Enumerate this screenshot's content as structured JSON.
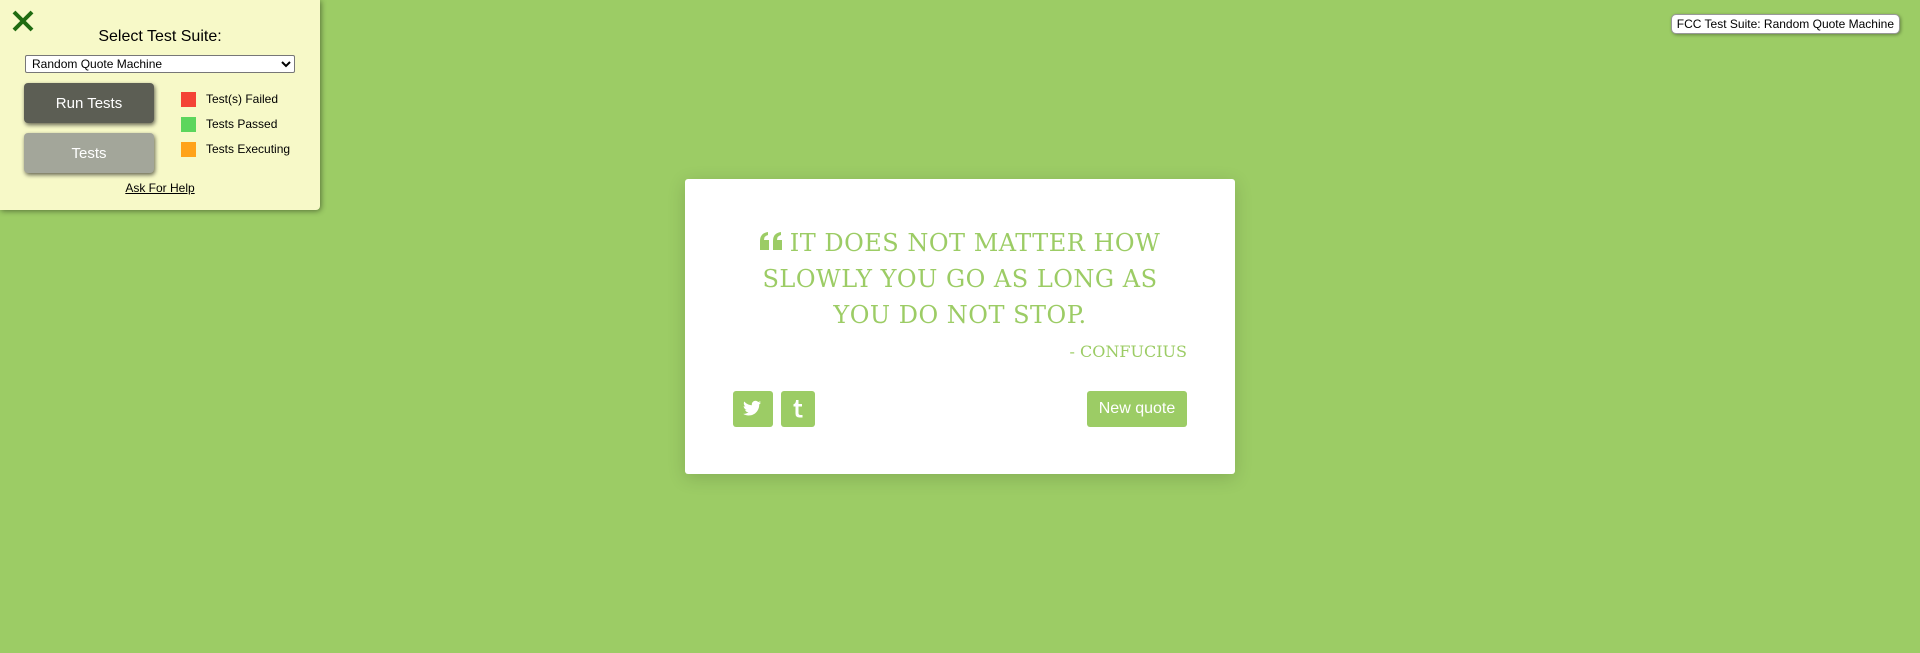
{
  "test_panel": {
    "title": "Select Test Suite:",
    "selected_suite": "Random Quote Machine",
    "run_tests_label": "Run Tests",
    "tests_label": "Tests",
    "help_label": "Ask For Help",
    "legend": [
      {
        "label": "Test(s) Failed",
        "color": "#f44336"
      },
      {
        "label": "Tests Passed",
        "color": "#5cd65c"
      },
      {
        "label": "Tests Executing",
        "color": "#ffa31a"
      }
    ],
    "close_icon_color": "#1f6b11"
  },
  "badge": {
    "label": "FCC Test Suite: Random Quote Machine"
  },
  "quote": {
    "text": "It does not matter how slowly you go as long as you do not stop.",
    "author": "- Confucius",
    "new_quote_label": "New quote",
    "accent_color": "#9ccc65"
  },
  "icons": {
    "quote": "quote-left-icon",
    "twitter": "twitter-icon",
    "tumblr": "tumblr-icon",
    "close": "close-icon"
  }
}
